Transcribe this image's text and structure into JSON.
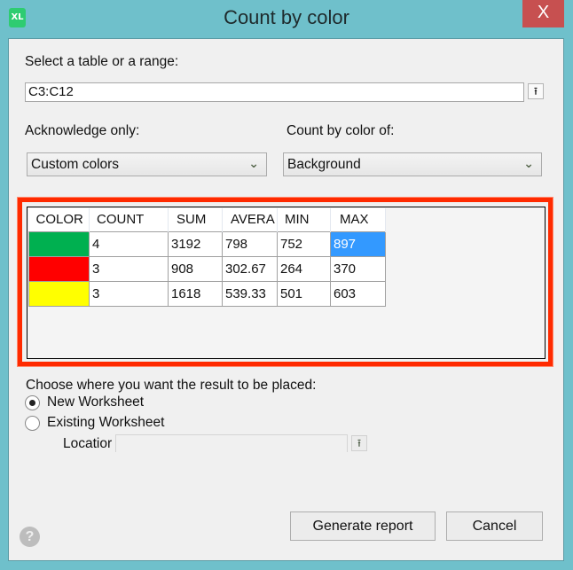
{
  "window": {
    "app_icon_text": "XL",
    "title": "Count by color",
    "close_glyph": "X"
  },
  "range": {
    "label": "Select a table or a range:",
    "value": "C3:C12",
    "picker_glyph": "⭱"
  },
  "acknowledge": {
    "label": "Acknowledge only:",
    "selected": "Custom colors"
  },
  "count_by": {
    "label": "Count by color of:",
    "selected": "Background"
  },
  "results": {
    "columns": [
      "COLOR",
      "COUNT",
      "SUM",
      "AVERA",
      "MIN",
      "MAX"
    ],
    "rows": [
      {
        "color": "#00b050",
        "count": "4",
        "sum": "3192",
        "average": "798",
        "min": "752",
        "max": "897"
      },
      {
        "color": "#ff0000",
        "count": "3",
        "sum": "908",
        "average": "302.67",
        "min": "264",
        "max": "370"
      },
      {
        "color": "#ffff00",
        "count": "3",
        "sum": "1618",
        "average": "539.33",
        "min": "501",
        "max": "603"
      }
    ],
    "selected_cell": "row 1 MAX",
    "highlight_color": "#ff2a00"
  },
  "placement": {
    "label": "Choose where you want the result to be placed:",
    "options": [
      {
        "label": "New Worksheet",
        "checked": true
      },
      {
        "label": "Existing Worksheet",
        "checked": false
      }
    ],
    "location_label": "Locatior",
    "location_value": ""
  },
  "buttons": {
    "generate": "Generate report",
    "cancel": "Cancel",
    "help": "?"
  }
}
